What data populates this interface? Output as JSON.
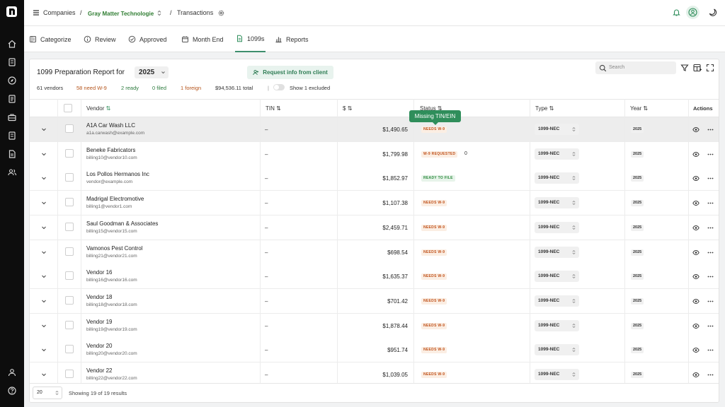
{
  "rail": {
    "logo_icon": "logo-mark",
    "items": [
      "home-icon",
      "receipt-icon",
      "compass-icon",
      "document-icon",
      "briefcase-icon",
      "ledger-icon",
      "file-icon",
      "users-icon",
      "user-icon",
      "help-icon"
    ]
  },
  "topbar": {
    "breadcrumb": {
      "companies": "Companies",
      "sep1": "/",
      "company": "Gray Matter Technologie",
      "sep2": "/",
      "page": "Transactions"
    }
  },
  "tabs": [
    {
      "label": "Categorize",
      "icon": "ledger-icon"
    },
    {
      "label": "Review",
      "icon": "info-icon"
    },
    {
      "label": "Approved",
      "icon": "check-circle-icon"
    },
    {
      "label": "Month End",
      "icon": "calendar-icon"
    },
    {
      "label": "1099s",
      "icon": "file-icon",
      "active": true
    },
    {
      "label": "Reports",
      "icon": "bar-chart-icon"
    }
  ],
  "report": {
    "title": "1099 Preparation Report for",
    "year": "2025",
    "request_button": "Request info from client",
    "search_placeholder": "Search",
    "stats": {
      "vendors": "61 vendors",
      "need_w9": "58 need W-9",
      "ready": "2 ready",
      "filed": "0 filed",
      "foreign": "1 foreign",
      "total": "$94,536.11 total",
      "divider": "|",
      "excluded_label": "Show 1 excluded"
    }
  },
  "table": {
    "headers": {
      "vendor": "Vendor",
      "tin": "TIN",
      "amount": "$",
      "status": "Status",
      "type": "Type",
      "year": "Year",
      "actions": "Actions"
    },
    "tooltip": "Missing TIN/EIN",
    "rows": [
      {
        "name": "A1A Car Wash LLC",
        "email": "a1a.carwash@example.com",
        "tin": "–",
        "amount": "$1,490.65",
        "status": "NEEDS W-9",
        "status_kind": "needs",
        "count": "",
        "type": "1099-NEC",
        "year": "2025"
      },
      {
        "name": "Beneke Fabricators",
        "email": "billing10@vendor10.com",
        "tin": "–",
        "amount": "$1,799.98",
        "status": "W-9 REQUESTED",
        "status_kind": "req",
        "count": "0",
        "type": "1099-NEC",
        "year": "2025"
      },
      {
        "name": "Los Pollos Hermanos Inc",
        "email": "vendor@example.com",
        "tin": "–",
        "amount": "$1,852.97",
        "status": "READY TO FILE",
        "status_kind": "ready",
        "count": "",
        "type": "1099-NEC",
        "year": "2025"
      },
      {
        "name": "Madrigal Electromotive",
        "email": "billing1@vendor1.com",
        "tin": "–",
        "amount": "$1,107.38",
        "status": "NEEDS W-9",
        "status_kind": "needs",
        "count": "",
        "type": "1099-NEC",
        "year": "2025"
      },
      {
        "name": "Saul Goodman & Associates",
        "email": "billing15@vendor15.com",
        "tin": "–",
        "amount": "$2,459.71",
        "status": "NEEDS W-9",
        "status_kind": "needs",
        "count": "",
        "type": "1099-NEC",
        "year": "2025"
      },
      {
        "name": "Vamonos Pest Control",
        "email": "billing21@vendor21.com",
        "tin": "–",
        "amount": "$698.54",
        "status": "NEEDS W-9",
        "status_kind": "needs",
        "count": "",
        "type": "1099-NEC",
        "year": "2025"
      },
      {
        "name": "Vendor 16",
        "email": "billing16@vendor16.com",
        "tin": "–",
        "amount": "$1,635.37",
        "status": "NEEDS W-9",
        "status_kind": "needs",
        "count": "",
        "type": "1099-NEC",
        "year": "2025"
      },
      {
        "name": "Vendor 18",
        "email": "billing18@vendor18.com",
        "tin": "–",
        "amount": "$701.42",
        "status": "NEEDS W-9",
        "status_kind": "needs",
        "count": "",
        "type": "1099-NEC",
        "year": "2025"
      },
      {
        "name": "Vendor 19",
        "email": "billing19@vendor19.com",
        "tin": "–",
        "amount": "$1,878.44",
        "status": "NEEDS W-9",
        "status_kind": "needs",
        "count": "",
        "type": "1099-NEC",
        "year": "2025"
      },
      {
        "name": "Vendor 20",
        "email": "billing20@vendor20.com",
        "tin": "–",
        "amount": "$951.74",
        "status": "NEEDS W-9",
        "status_kind": "needs",
        "count": "",
        "type": "1099-NEC",
        "year": "2025"
      },
      {
        "name": "Vendor 22",
        "email": "billing22@vendor22.com",
        "tin": "–",
        "amount": "$1,039.05",
        "status": "NEEDS W-9",
        "status_kind": "needs",
        "count": "",
        "type": "1099-NEC",
        "year": "2025"
      }
    ]
  },
  "footer": {
    "page_size": "20",
    "showing": "Showing 19 of 19 results"
  },
  "colors": {
    "accent": "#2f8e5b",
    "needs": "#c0521c",
    "ready": "#2d8a3e",
    "rail": "#0d0d0d"
  }
}
